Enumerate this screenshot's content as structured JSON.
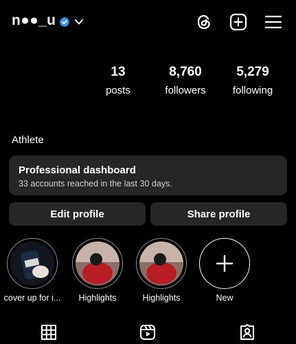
{
  "header": {
    "username": "n●●_u",
    "icons": [
      "threads-icon",
      "create-plus-icon",
      "menu-icon"
    ]
  },
  "stats": {
    "posts": {
      "value": "13",
      "label": "posts"
    },
    "followers": {
      "value": "8,760",
      "label": "followers"
    },
    "following": {
      "value": "5,279",
      "label": "following"
    }
  },
  "profile": {
    "category": "Athlete"
  },
  "dashboard": {
    "title": "Professional dashboard",
    "subtitle": "33 accounts reached in the last 30 days."
  },
  "actions": {
    "edit": "Edit profile",
    "share": "Share profile"
  },
  "highlights": [
    {
      "label": "cover up for i..."
    },
    {
      "label": "Highlights"
    },
    {
      "label": "Highlights"
    },
    {
      "label": "New"
    }
  ],
  "tabs": [
    "grid-icon",
    "reels-icon",
    "tagged-icon"
  ],
  "colors": {
    "background": "#000000",
    "surface": "#262626",
    "verified": "#3897f0",
    "text": "#ffffff"
  }
}
